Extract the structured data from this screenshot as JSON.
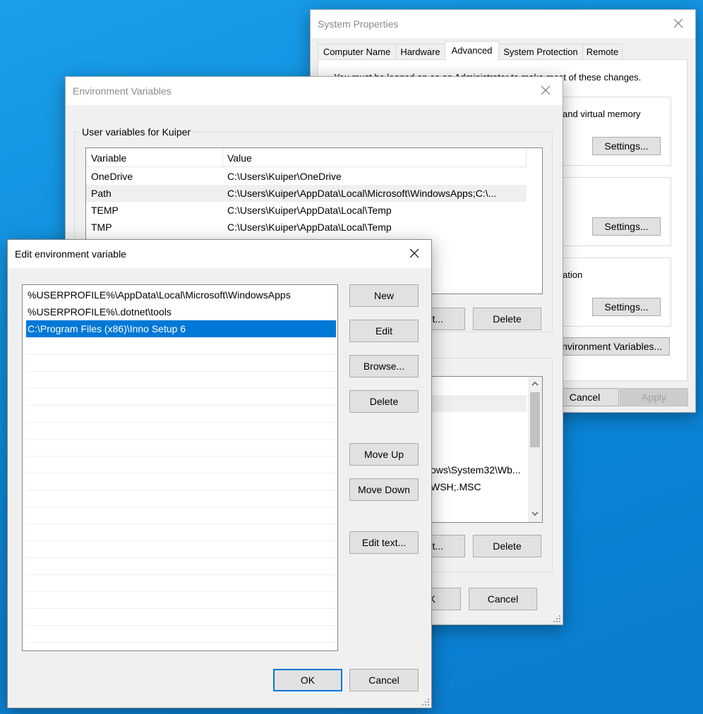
{
  "sysprops": {
    "title": "System Properties",
    "tabs": [
      "Computer Name",
      "Hardware",
      "Advanced",
      "System Protection",
      "Remote"
    ],
    "admin_note": "You must be logged on as an Administrator to make most of these changes.",
    "perf_desc": "and virtual memory",
    "settings_label": "Settings...",
    "startup_desc": "ation",
    "env_button": "Environment Variables...",
    "cancel": "Cancel",
    "apply": "Apply"
  },
  "envvars": {
    "title": "Environment Variables",
    "user_group_label": "User variables for Kuiper",
    "columns": [
      "Variable",
      "Value"
    ],
    "user_rows": [
      {
        "name": "OneDrive",
        "value": "C:\\Users\\Kuiper\\OneDrive"
      },
      {
        "name": "Path",
        "value": "C:\\Users\\Kuiper\\AppData\\Local\\Microsoft\\WindowsApps;C:\\..."
      },
      {
        "name": "TEMP",
        "value": "C:\\Users\\Kuiper\\AppData\\Local\\Temp"
      },
      {
        "name": "TMP",
        "value": "C:\\Users\\Kuiper\\AppData\\Local\\Temp"
      }
    ],
    "edit_partial": "it...",
    "delete": "Delete",
    "sys_partial_1": "ows\\System32\\Wb...",
    "sys_partial_2": "WSH;.MSC",
    "ok_partial": "K",
    "cancel": "Cancel"
  },
  "editdlg": {
    "title": "Edit environment variable",
    "entries": [
      "%USERPROFILE%\\AppData\\Local\\Microsoft\\WindowsApps",
      "%USERPROFILE%\\.dotnet\\tools",
      "C:\\Program Files (x86)\\Inno Setup 6"
    ],
    "buttons": {
      "new": "New",
      "edit": "Edit",
      "browse": "Browse...",
      "delete": "Delete",
      "move_up": "Move Up",
      "move_down": "Move Down",
      "edit_text": "Edit text...",
      "ok": "OK",
      "cancel": "Cancel"
    }
  },
  "colors": {
    "desktop": "#0a86d8",
    "selection": "#0078d7",
    "default_button_border": "#0078d7"
  }
}
